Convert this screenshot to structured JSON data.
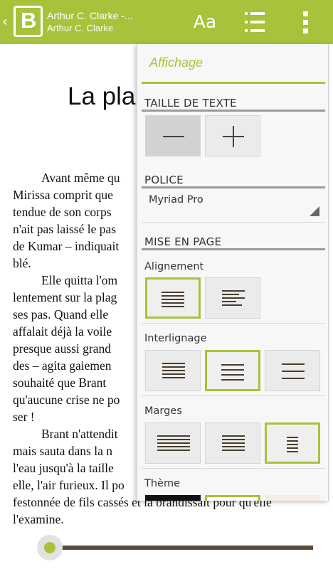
{
  "header": {
    "book_title": "Arthur C. Clarke -...",
    "book_author": "Arthur C. Clarke",
    "logo_letter": "B",
    "back_glyph": "‹",
    "font_button_label": "Aa",
    "accent_color": "#a7c23b"
  },
  "reader": {
    "chapter_title": "La pla",
    "paragraphs": [
      "Avant même qu",
      "Mirissa comprit que",
      "tendue de son corps",
      "n'ait pas laissé le pas",
      "de Kumar – indiquait",
      "blé.",
      "Elle quitta l'om",
      "lentement sur la plag",
      "ses pas. Quand elle",
      "affalait déjà la voile",
      "presque aussi grand",
      "des – agita gaiemen",
      "souhaité que Brant",
      "qu'aucune crise ne po",
      "ser !",
      "Brant n'attendit",
      "mais sauta dans la n",
      "l'eau jusqu'à la taille",
      "elle, l'air furieux. Il po",
      "festonnée de fils cassés et la brandissait pour qu'elle",
      "l'examine."
    ],
    "progress_fraction": 0.0
  },
  "panel": {
    "title": "Affichage",
    "text_size": {
      "label": "TAILLE DE TEXTE",
      "decrease_icon": "minus-icon",
      "increase_icon": "plus-icon"
    },
    "font": {
      "label": "POLICE",
      "selected": "Myriad Pro"
    },
    "layout": {
      "label": "MISE EN PAGE",
      "alignment": {
        "label": "Alignement",
        "options": [
          "justify",
          "left"
        ],
        "selected": "justify"
      },
      "line_spacing": {
        "label": "Interlignage",
        "options": [
          "compact",
          "normal",
          "wide"
        ],
        "selected": "normal"
      },
      "margins": {
        "label": "Marges",
        "options": [
          "small",
          "medium",
          "large"
        ],
        "selected": "large"
      },
      "theme": {
        "label": "Thème",
        "options": [
          "#111111",
          "#ffffff",
          "#f4efe3"
        ],
        "selected": 1
      }
    }
  }
}
